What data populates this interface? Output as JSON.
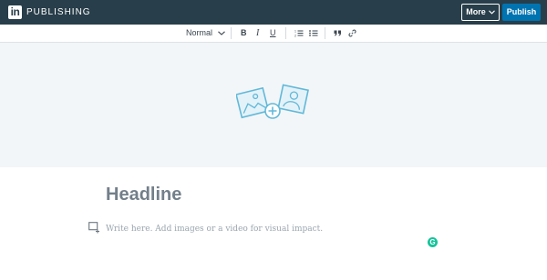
{
  "header": {
    "logo_text": "in",
    "brand": "PUBLISHING",
    "more_label": "More",
    "publish_label": "Publish"
  },
  "toolbar": {
    "style_select": "Normal",
    "bold_label": "B",
    "italic_label": "I",
    "underline_label": "U"
  },
  "editor": {
    "headline_placeholder": "Headline",
    "body_placeholder": "Write here. Add images or a video for visual impact."
  },
  "grammarly": {
    "label": "G"
  },
  "colors": {
    "header_bg": "#283e4a",
    "publish_blue": "#0073b1",
    "hero_bg": "#f3f6f8",
    "icon_blue": "#61b8d8",
    "grammarly_green": "#15c39a"
  }
}
